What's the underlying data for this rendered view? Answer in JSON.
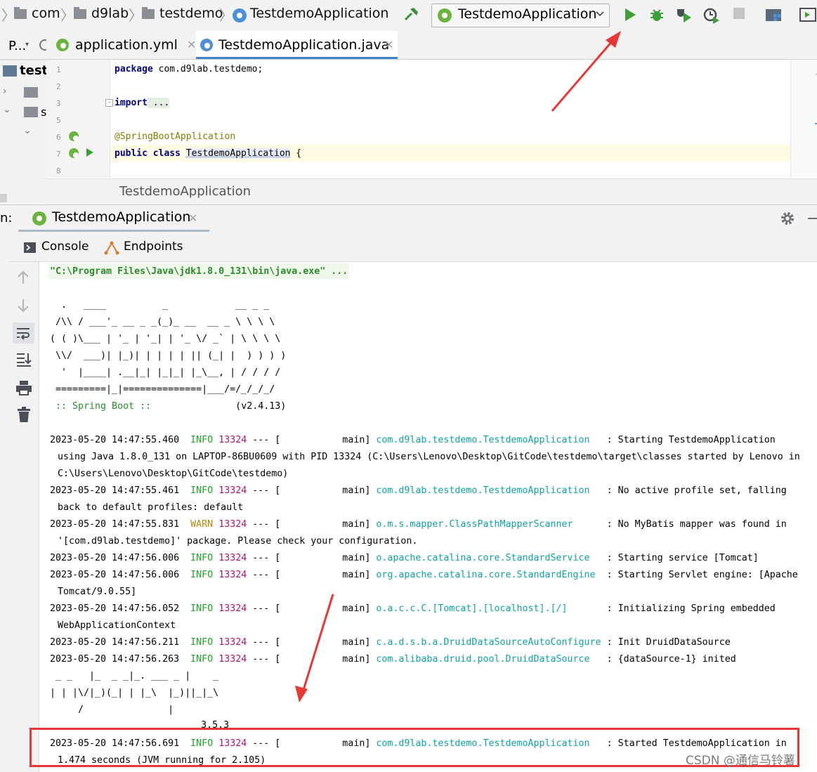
{
  "navbar": {
    "crumbs": [
      "com",
      "d9lab",
      "testdemo",
      "TestdemoApplication"
    ],
    "run_config": "TestdemoApplication"
  },
  "project_panel": {
    "tab_label": "P...",
    "root_label": "test"
  },
  "editor": {
    "tabs": [
      {
        "label": "application.yml",
        "active": false
      },
      {
        "label": "TestdemoApplication.java",
        "active": true
      }
    ],
    "line_numbers": [
      "1",
      "2",
      "3",
      "5",
      "6",
      "7",
      "8"
    ],
    "lines": {
      "l1_kw": "package",
      "l1_rest": " com.d9lab.testdemo;",
      "l3_kw": "import",
      "l3_rest": " ...",
      "l6": "@SpringBootApplication",
      "l7_kw1": "public",
      "l7_kw2": "class",
      "l7_name": "TestdemoApplication",
      "l7_rest": " {"
    },
    "breadcrumb": "TestdemoApplication"
  },
  "run_window": {
    "prefix": "n:",
    "tab_label": "TestdemoApplication",
    "sub_tabs": [
      "Console",
      "Endpoints"
    ]
  },
  "console": {
    "cmd": "\"C:\\Program Files\\Java\\jdk1.8.0_131\\bin\\java.exe\" ...",
    "spring_banner": [
      "  .   ____          _            __ _ _",
      " /\\\\ / ___'_ __ _ _(_)_ __  __ _ \\ \\ \\ \\",
      "( ( )\\___ | '_ | '_| | '_ \\/ _` | \\ \\ \\ \\",
      " \\\\/  ___)| |_)| | | | | || (_| |  ) ) ) )",
      "  '  |____| .__|_| |_|_| |_\\__, | / / / /",
      " =========|_|==============|___/=/_/_/_/"
    ],
    "boot_label": " :: Spring Boot :: ",
    "boot_version": "              (v2.4.13)",
    "logs": [
      {
        "ts": "2023-05-20 14:47:55.460",
        "level": "INFO",
        "pid": "13324",
        "sep": " --- [           main] ",
        "logger": "com.d9lab.testdemo.TestdemoApplication",
        "pad": "   : ",
        "msg": "Starting TestdemoApplication",
        "cont": [
          "using Java 1.8.0_131 on LAPTOP-86BU0609 with PID 13324 (C:\\Users\\Lenovo\\Desktop\\GitCode\\testdemo\\target\\classes started by Lenovo in",
          "C:\\Users\\Lenovo\\Desktop\\GitCode\\testdemo)"
        ]
      },
      {
        "ts": "2023-05-20 14:47:55.461",
        "level": "INFO",
        "pid": "13324",
        "sep": " --- [           main] ",
        "logger": "com.d9lab.testdemo.TestdemoApplication",
        "pad": "   : ",
        "msg": "No active profile set, falling",
        "cont": [
          "back to default profiles: default"
        ]
      },
      {
        "ts": "2023-05-20 14:47:55.831",
        "level": "WARN",
        "pid": "13324",
        "sep": " --- [           main] ",
        "logger": "o.m.s.mapper.ClassPathMapperScanner",
        "pad": "      : ",
        "msg": "No MyBatis mapper was found in",
        "cont": [
          "'[com.d9lab.testdemo]' package. Please check your configuration."
        ]
      },
      {
        "ts": "2023-05-20 14:47:56.006",
        "level": "INFO",
        "pid": "13324",
        "sep": " --- [           main] ",
        "logger": "o.apache.catalina.core.StandardService",
        "pad": "   : ",
        "msg": "Starting service [Tomcat]",
        "cont": []
      },
      {
        "ts": "2023-05-20 14:47:56.006",
        "level": "INFO",
        "pid": "13324",
        "sep": " --- [           main] ",
        "logger": "org.apache.catalina.core.StandardEngine",
        "pad": "  : ",
        "msg": "Starting Servlet engine: [Apache",
        "cont": [
          "Tomcat/9.0.55]"
        ]
      },
      {
        "ts": "2023-05-20 14:47:56.052",
        "level": "INFO",
        "pid": "13324",
        "sep": " --- [           main] ",
        "logger": "o.a.c.c.C.[Tomcat].[localhost].[/]",
        "pad": "       : ",
        "msg": "Initializing Spring embedded",
        "cont": [
          "WebApplicationContext"
        ]
      },
      {
        "ts": "2023-05-20 14:47:56.211",
        "level": "INFO",
        "pid": "13324",
        "sep": " --- [           main] ",
        "logger": "c.a.d.s.b.a.DruidDataSourceAutoConfigure",
        "pad": " : ",
        "msg": "Init DruidDataSource",
        "cont": []
      },
      {
        "ts": "2023-05-20 14:47:56.263",
        "level": "INFO",
        "pid": "13324",
        "sep": " --- [           main] ",
        "logger": "com.alibaba.druid.pool.DruidDataSource",
        "pad": "   : ",
        "msg": "{dataSource-1} inited",
        "cont": []
      }
    ],
    "mybatis_banner": [
      " _ _   |_  _ _|_. ___ _ |    _",
      "| | |\\/|_)(_| | |_\\  |_)||_|_\\",
      "     /               |",
      "                        3.5.3"
    ],
    "final_log": {
      "ts": "2023-05-20 14:47:56.691",
      "level": "INFO",
      "pid": "13324",
      "sep": " --- [           main] ",
      "logger": "com.d9lab.testdemo.TestdemoApplication",
      "pad": "   : ",
      "msg": "Started TestdemoApplication in",
      "cont": [
        "1.474 seconds (JVM running for 2.105)"
      ]
    }
  },
  "watermark": "CSDN @通信马铃薯",
  "colors": {
    "accent_green": "#3e9e3a",
    "highlight_box": "#e53935",
    "arrow": "#e53935"
  }
}
